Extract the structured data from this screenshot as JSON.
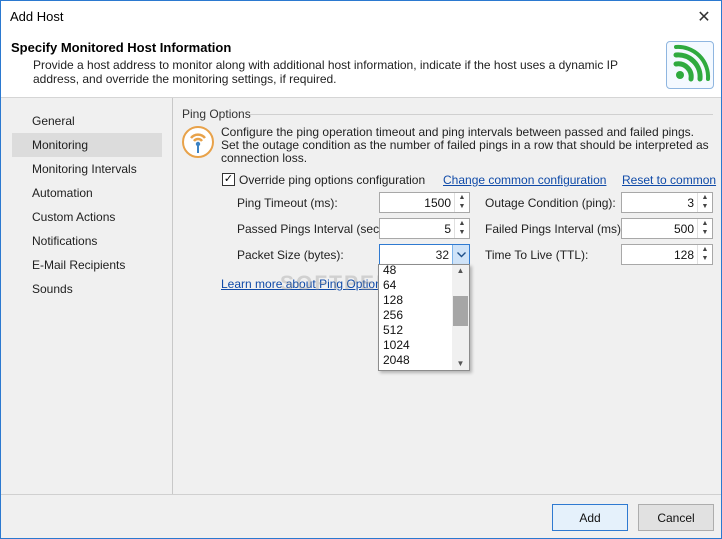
{
  "window": {
    "title": "Add Host",
    "close_glyph": "✕"
  },
  "header": {
    "title": "Specify Monitored Host Information",
    "description": "Provide a host address to monitor along with additional host information, indicate if the host uses a dynamic IP address, and override the monitoring settings, if required.",
    "icon": "wifi-signal-icon",
    "icon_color": "#2faa3e"
  },
  "sidebar": {
    "items": [
      {
        "label": "General"
      },
      {
        "label": "Monitoring"
      },
      {
        "label": "Monitoring Intervals"
      },
      {
        "label": "Automation"
      },
      {
        "label": "Custom Actions"
      },
      {
        "label": "Notifications"
      },
      {
        "label": "E-Mail Recipients"
      },
      {
        "label": "Sounds"
      }
    ],
    "active_index": 1
  },
  "ping": {
    "group_title": "Ping Options",
    "description": "Configure the ping operation timeout and ping intervals between passed and failed pings. Set the outage condition as the number of failed pings in a row that should be interpreted as connection loss.",
    "override_label": "Override ping options configuration",
    "override_checked": true,
    "change_link": "Change common configuration",
    "reset_link": "Reset to common",
    "fields": {
      "ping_timeout": {
        "label": "Ping Timeout (ms):",
        "value": "1500"
      },
      "outage_condition": {
        "label": "Outage Condition (ping):",
        "value": "3"
      },
      "passed_interval": {
        "label": "Passed Pings Interval (sec):",
        "value": "5"
      },
      "failed_interval": {
        "label": "Failed Pings Interval (ms):",
        "value": "500"
      },
      "packet_size": {
        "label": "Packet Size (bytes):",
        "value": "32"
      },
      "ttl": {
        "label": "Time To Live (TTL):",
        "value": "128"
      }
    },
    "packet_size_options": [
      "48",
      "64",
      "128",
      "256",
      "512",
      "1024",
      "2048"
    ],
    "learn_more": "Learn more about Ping Options"
  },
  "watermark": "SOFTPEDIA",
  "footer": {
    "add_label": "Add",
    "cancel_label": "Cancel"
  },
  "colors": {
    "accent": "#2f7ad1",
    "link": "#0f4aa8"
  }
}
